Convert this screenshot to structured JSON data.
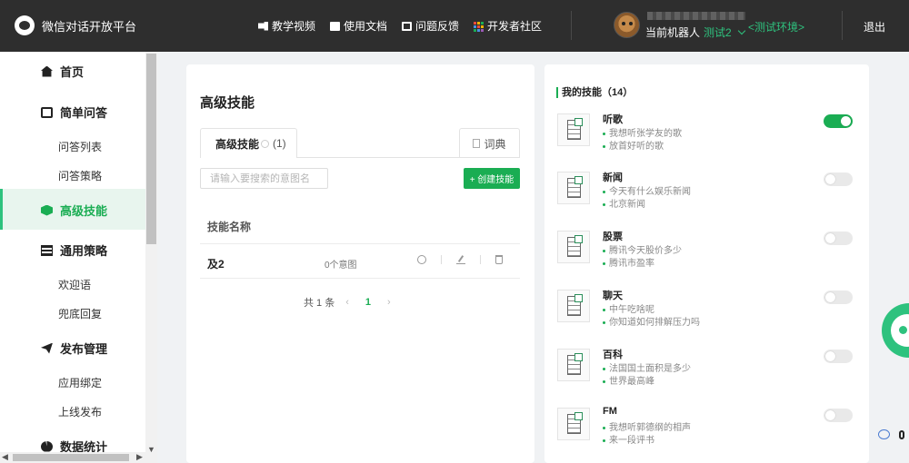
{
  "topbar": {
    "logo_text": "微信对话开放平台",
    "nav": [
      {
        "label": "教学视频",
        "icon": "video-icon"
      },
      {
        "label": "使用文档",
        "icon": "document-icon"
      },
      {
        "label": "问题反馈",
        "icon": "feedback-icon"
      },
      {
        "label": "开发者社区",
        "icon": "grid-icon"
      }
    ],
    "robot_prefix": "当前机器人",
    "robot_name": "测试2",
    "env_tag": "<测试环境>",
    "logout": "退出"
  },
  "sidebar": {
    "items": [
      {
        "label": "首页",
        "icon": "home-icon"
      },
      {
        "label": "简单问答",
        "icon": "qa-icon"
      },
      {
        "label": "问答列表"
      },
      {
        "label": "问答策略"
      },
      {
        "label": "高级技能",
        "icon": "cube-icon",
        "active": true
      },
      {
        "label": "通用策略",
        "icon": "list-icon"
      },
      {
        "label": "欢迎语"
      },
      {
        "label": "兜底回复"
      },
      {
        "label": "发布管理",
        "icon": "send-icon"
      },
      {
        "label": "应用绑定"
      },
      {
        "label": "上线发布"
      },
      {
        "label": "数据统计",
        "icon": "pie-chart-icon"
      }
    ]
  },
  "main": {
    "title": "高级技能",
    "tab_active": "高级技能",
    "tab_count": "(1)",
    "tab_dict": "词典",
    "search_placeholder": "请输入要搜索的意图名",
    "create_button": "+ 创建技能",
    "table_header": "技能名称",
    "rows": [
      {
        "name": "及2",
        "intents": "0个意图"
      }
    ],
    "pager": {
      "total": "共 1 条",
      "prev": "‹",
      "current": "1",
      "next": "›"
    }
  },
  "my_skills": {
    "title": "我的技能（14）",
    "items": [
      {
        "name": "听歌",
        "examples": [
          "我想听张学友的歌",
          "放首好听的歌"
        ],
        "enabled": true
      },
      {
        "name": "新闻",
        "examples": [
          "今天有什么娱乐新闻",
          "北京新闻"
        ],
        "enabled": false
      },
      {
        "name": "股票",
        "examples": [
          "腾讯今天股价多少",
          "腾讯市盈率"
        ],
        "enabled": false
      },
      {
        "name": "聊天",
        "examples": [
          "中午吃啥呢",
          "你知道如何排解压力吗"
        ],
        "enabled": false
      },
      {
        "name": "百科",
        "examples": [
          "法国国土面积是多少",
          "世界最高峰"
        ],
        "enabled": false
      },
      {
        "name": "FM",
        "examples": [
          "我想听郭德纲的相声",
          "来一段评书"
        ],
        "enabled": false
      }
    ]
  },
  "colors": {
    "accent": "#1aad53",
    "topbar": "#2e2e2e",
    "env_tag": "#2ec27e"
  }
}
